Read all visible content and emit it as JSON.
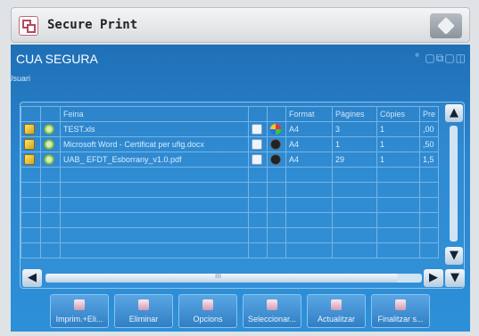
{
  "app": {
    "title": "Secure Print"
  },
  "panel": {
    "title": "CUA SEGURA",
    "user_label": "Usuari",
    "indicator_glyphs": "° ▢⧉▢◫"
  },
  "table": {
    "headers": [
      "",
      "",
      "Feina",
      "",
      "",
      "Format",
      "Pàgines",
      "Còpies",
      "Pre"
    ],
    "rows": [
      {
        "name": "TEST.xls",
        "format": "A4",
        "pages": "3",
        "copies": "1",
        "price": ",00",
        "color_icon": "color-icon"
      },
      {
        "name": "Microsoft Word - Certificat per ufig.docx",
        "format": "A4",
        "pages": "1",
        "copies": "1",
        "price": ",50",
        "color_icon": "bw-icon"
      },
      {
        "name": "UAB_ EFDT_Esborrany_v1.0.pdf",
        "format": "A4",
        "pages": "29",
        "copies": "1",
        "price": "1,5",
        "color_icon": "bw-icon"
      }
    ],
    "empty_rows": 6
  },
  "scroll": {
    "up": "▲",
    "down": "▼",
    "left": "◀",
    "right": "▶",
    "thumb_grip": "III"
  },
  "buttons": [
    {
      "label": "Imprim.+Eli...",
      "icon": "print-delete-icon"
    },
    {
      "label": "Eliminar",
      "icon": "delete-icon"
    },
    {
      "label": "Opcions",
      "icon": "options-icon"
    },
    {
      "label": "Seleccionar...",
      "icon": "select-icon"
    },
    {
      "label": "Actualitzar",
      "icon": "refresh-icon"
    },
    {
      "label": "Finalitzar s...",
      "icon": "finish-session-icon"
    }
  ]
}
